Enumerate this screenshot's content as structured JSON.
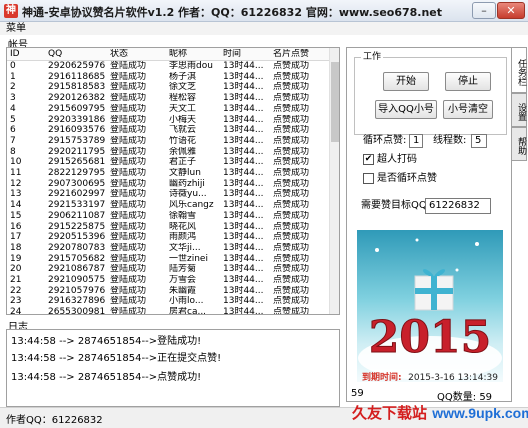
{
  "window": {
    "title": "神通-安卓协议赞名片软件v1.2  作者：QQ：61226832  官网：www.seo678.net",
    "min_glyph": "–",
    "close_glyph": "✕"
  },
  "menu": {
    "label": "菜单"
  },
  "account": {
    "label": "帐号"
  },
  "table": {
    "columns": [
      "ID",
      "QQ",
      "状态",
      "昵称",
      "时间",
      "名片点赞"
    ],
    "rows": [
      [
        "0",
        "2920625976",
        "登陆成功",
        "李思雨dou",
        "13时44...",
        "点赞成功"
      ],
      [
        "1",
        "2916118685",
        "登陆成功",
        "杨子淇",
        "13时44...",
        "点赞成功"
      ],
      [
        "2",
        "2915818583",
        "登陆成功",
        "徐文芝",
        "13时44...",
        "点赞成功"
      ],
      [
        "3",
        "2920126382",
        "登陆成功",
        "程松容",
        "13时44...",
        "点赞成功"
      ],
      [
        "4",
        "2915609795",
        "登陆成功",
        "天文工",
        "13时44...",
        "点赞成功"
      ],
      [
        "5",
        "2920339186",
        "登陆成功",
        "小梅天",
        "13时44...",
        "点赞成功"
      ],
      [
        "6",
        "2916093576",
        "登陆成功",
        "飞就云",
        "13时44...",
        "点赞成功"
      ],
      [
        "7",
        "2915753789",
        "登陆成功",
        "竹语花",
        "13时44...",
        "点赞成功"
      ],
      [
        "8",
        "2920211795",
        "登陆成功",
        "余佩雅",
        "13时44...",
        "点赞成功"
      ],
      [
        "10",
        "2915265681",
        "登陆成功",
        "君芷子",
        "13时44...",
        "点赞成功"
      ],
      [
        "11",
        "2822129795",
        "登陆成功",
        "文静lun",
        "13时44...",
        "点赞成功"
      ],
      [
        "12",
        "2907300695",
        "登陆成功",
        "幽药zhiji",
        "13时44...",
        "点赞成功"
      ],
      [
        "13",
        "2921602997",
        "登陆成功",
        "诗薇yu...",
        "13时44...",
        "点赞成功"
      ],
      [
        "14",
        "2921533197",
        "登陆成功",
        "风乐cangz",
        "13时44...",
        "点赞成功"
      ],
      [
        "15",
        "2906211087",
        "登陆成功",
        "徐翰雪",
        "13时44...",
        "点赞成功"
      ],
      [
        "16",
        "2915225875",
        "登陆成功",
        "晓花风",
        "13时44...",
        "点赞成功"
      ],
      [
        "17",
        "2920515396",
        "登陆成功",
        "雨颜鸿",
        "13时44...",
        "点赞成功"
      ],
      [
        "18",
        "2920780783",
        "登陆成功",
        "文华ji...",
        "13时44...",
        "点赞成功"
      ],
      [
        "19",
        "2915705682",
        "登陆成功",
        "一世zinei",
        "13时44...",
        "点赞成功"
      ],
      [
        "20",
        "2921086787",
        "登陆成功",
        "陆芳菊",
        "13时44...",
        "点赞成功"
      ],
      [
        "21",
        "2921090575",
        "登陆成功",
        "万雪会",
        "13时44...",
        "点赞成功"
      ],
      [
        "22",
        "2921057976",
        "登陆成功",
        "朱幽霞",
        "13时44...",
        "点赞成功"
      ],
      [
        "23",
        "2916327896",
        "登陆成功",
        "小雨lo...",
        "13时44...",
        "点赞成功"
      ],
      [
        "24",
        "2655300981",
        "登陆成功",
        "房君ca...",
        "13时44...",
        "点赞成功"
      ]
    ]
  },
  "log": {
    "label": "日志",
    "lines": [
      "13:44:58 --> 2874651854-->登陆成功!",
      "13:44:58 --> 2874651854-->正在提交点赞!",
      "13:44:58 --> 2874651854-->点赞成功!"
    ]
  },
  "right_tabs": [
    "任务栏",
    "设置",
    "帮助"
  ],
  "work": {
    "group_title": "工作",
    "start": "开始",
    "stop": "停止",
    "import": "导入QQ小号",
    "clear": "小号清空",
    "loop_label": "循环点赞:",
    "loop_value": "1",
    "threads_label": "线程数:",
    "threads_value": "5",
    "super_label": "超人打码",
    "super_checked": "✔",
    "cycle_label": "是否循环点赞",
    "target_label": "需要赞目标QQ:",
    "target_value": "61226832",
    "expire_label": "到期时间:",
    "expire_value": "2015-3-16 13:14:39",
    "year_text": "2015",
    "count_left": "59",
    "qq_count_label": "QQ数量:",
    "qq_count_value": "59"
  },
  "status": {
    "author": "作者QQ：61226832"
  },
  "watermark": {
    "cn": "久友下载站",
    "url": "www.9upk.com"
  },
  "colors": {
    "expire_red": "#d6352b",
    "watermark_red": "#d41e1e",
    "watermark_blue": "#1f6fd6"
  }
}
